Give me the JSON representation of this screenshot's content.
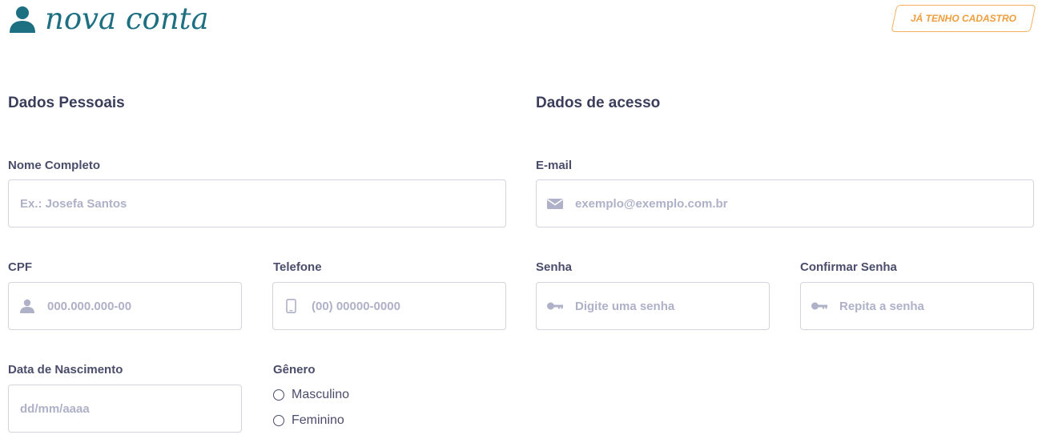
{
  "header": {
    "title": "nova conta",
    "login_button": "JÁ TENHO CADASTRO"
  },
  "sections": {
    "personal": "Dados Pessoais",
    "access": "Dados de acesso"
  },
  "fields": {
    "full_name": {
      "label": "Nome Completo",
      "placeholder": "Ex.: Josefa Santos",
      "value": ""
    },
    "email": {
      "label": "E-mail",
      "placeholder": "exemplo@exemplo.com.br",
      "value": ""
    },
    "cpf": {
      "label": "CPF",
      "placeholder": "000.000.000-00",
      "value": ""
    },
    "phone": {
      "label": "Telefone",
      "placeholder": "(00) 00000-0000",
      "value": ""
    },
    "password": {
      "label": "Senha",
      "placeholder": "Digite uma senha",
      "value": ""
    },
    "confirm_password": {
      "label": "Confirmar Senha",
      "placeholder": "Repita a senha",
      "value": ""
    },
    "birth_date": {
      "label": "Data de Nascimento",
      "placeholder": "dd/mm/aaaa",
      "value": ""
    }
  },
  "gender": {
    "label": "Gênero",
    "options": [
      "Masculino",
      "Feminino"
    ]
  },
  "colors": {
    "title": "#1d6f82",
    "accent": "#ee9e3c",
    "text": "#4a4d6a",
    "placeholder": "#aeb1c7",
    "border": "#d3d4dc"
  },
  "icons": {
    "title_icon": "user-icon",
    "cpf_icon": "user-icon",
    "phone_icon": "mobile-phone-icon",
    "email_icon": "envelope-icon",
    "password_icon": "key-icon"
  }
}
